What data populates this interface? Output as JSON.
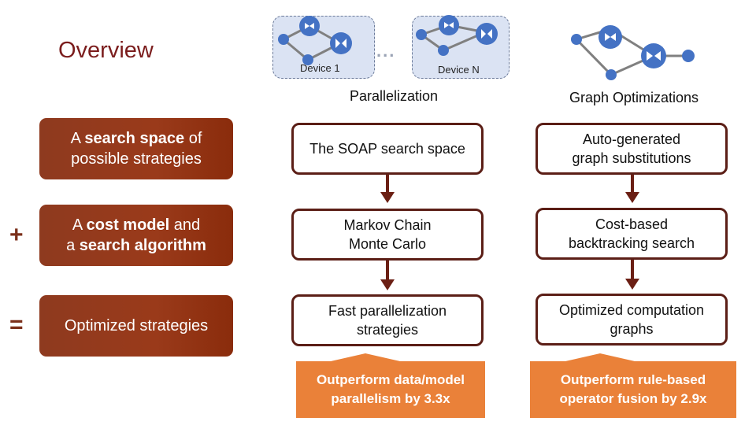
{
  "slide": {
    "title": "Overview"
  },
  "devices": {
    "device_1_label": "Device 1",
    "device_n_label": "Device N",
    "ellipsis": "..."
  },
  "columns": {
    "parallelization": {
      "heading": "Parallelization",
      "boxes": [
        {
          "text": "The SOAP search space"
        },
        {
          "text_line1": "Markov Chain",
          "text_line2": "Monte Carlo"
        },
        {
          "text_line1": "Fast parallelization",
          "text_line2": "strategies"
        }
      ],
      "callout": {
        "line1": "Outperform data/model",
        "line2": "parallelism by 3.3x"
      }
    },
    "graph_optimizations": {
      "heading": "Graph Optimizations",
      "boxes": [
        {
          "text_line1": "Auto-generated",
          "text_line2": "graph substitutions"
        },
        {
          "text_line1": "Cost-based",
          "text_line2": "backtracking search"
        },
        {
          "text_line1": "Optimized computation",
          "text_line2": "graphs"
        }
      ],
      "callout": {
        "line1": "Outperform rule-based",
        "line2": "operator fusion by 2.9x"
      }
    }
  },
  "equation": {
    "row1": {
      "pre": "A ",
      "bold": "search space",
      "post": " of",
      "line2": "possible strategies"
    },
    "row2": {
      "operator": "+",
      "pre": "A ",
      "bold1": "cost model",
      "mid": " and",
      "line2_pre": "a ",
      "line2_bold": "search algorithm"
    },
    "row3": {
      "operator": "=",
      "text": "Optimized strategies"
    }
  },
  "colors": {
    "brand_brown": "#8e3a1f",
    "title_red": "#7b1d1d",
    "callout_orange": "#ea8139",
    "node_blue": "#4472c4",
    "device_fill": "#dbe3f3"
  },
  "icons": {
    "graph_node": "computation-graph-icon",
    "arrow": "down-arrow-icon"
  }
}
